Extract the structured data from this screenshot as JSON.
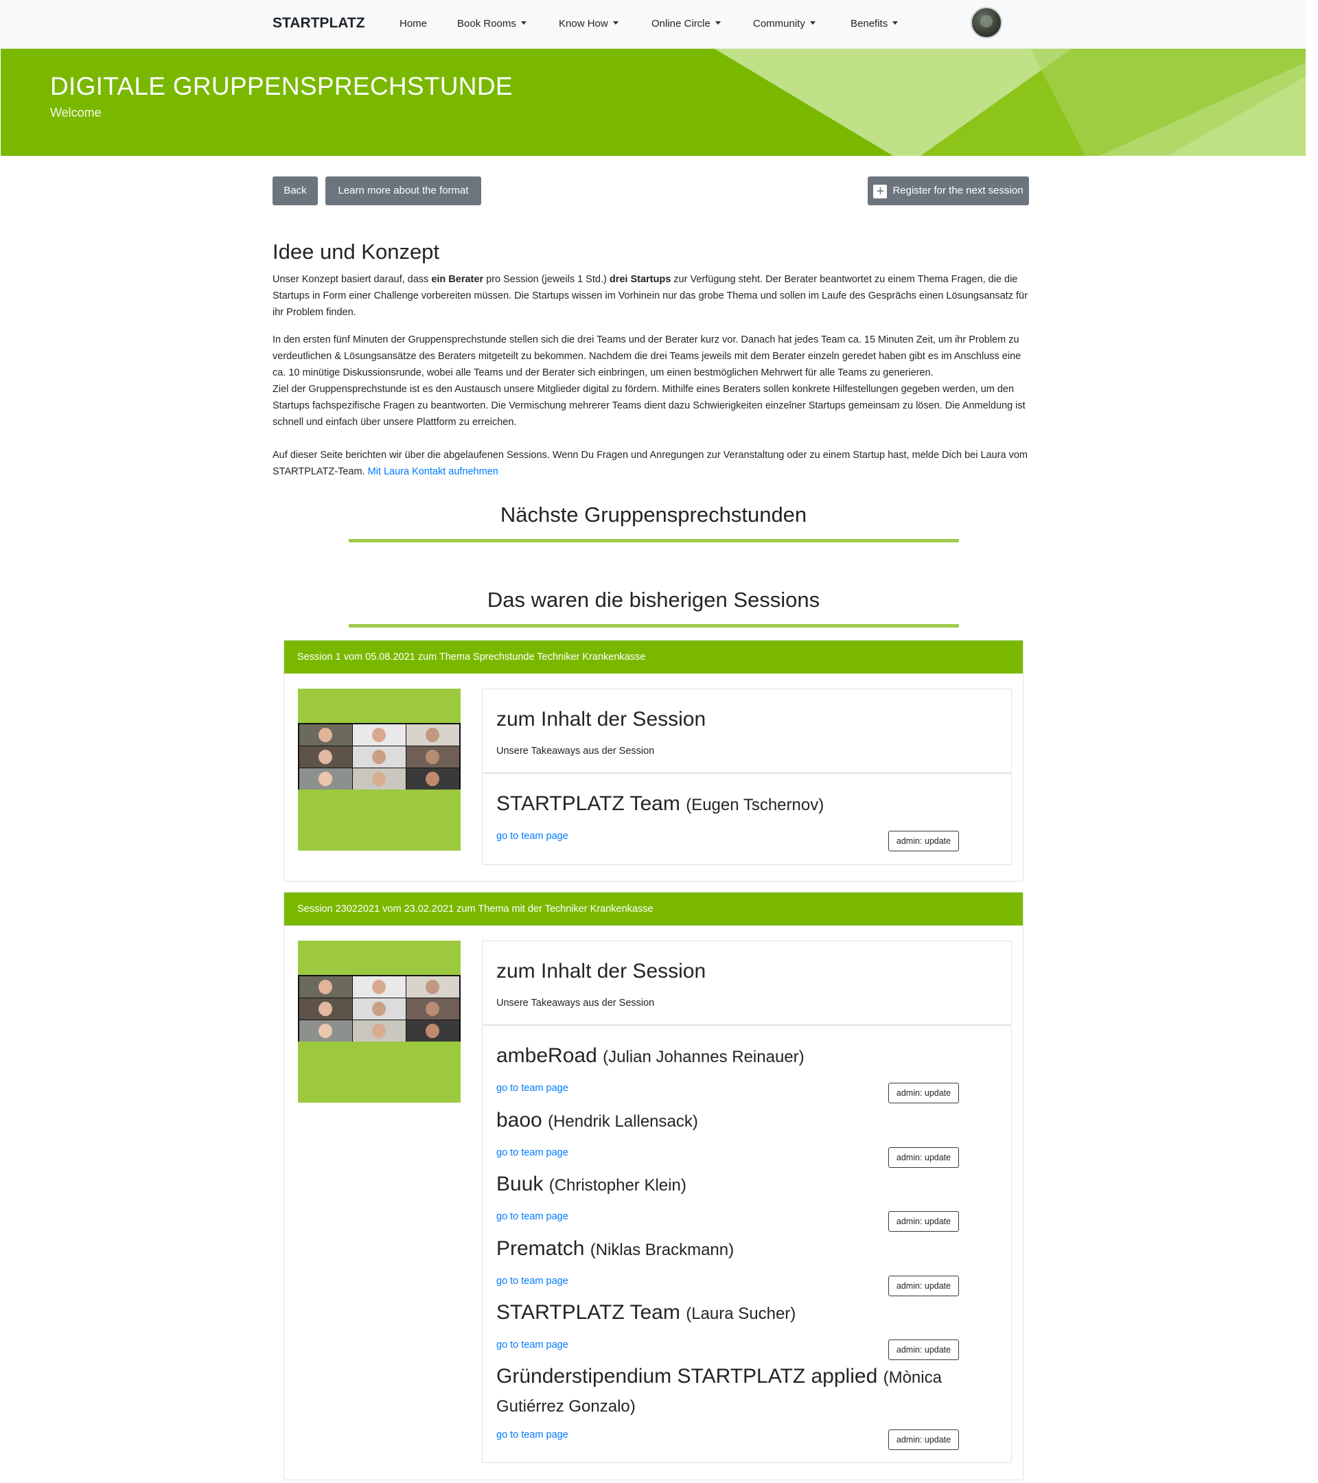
{
  "nav": {
    "brand": "STARTPLATZ",
    "items": [
      {
        "label": "Home",
        "dropdown": false
      },
      {
        "label": "Book Rooms",
        "dropdown": true
      },
      {
        "label": "Know How",
        "dropdown": true
      },
      {
        "label": "Online Circle",
        "dropdown": true
      },
      {
        "label": "Community",
        "dropdown": true
      },
      {
        "label": "Benefits",
        "dropdown": true
      }
    ]
  },
  "hero": {
    "title": "DIGITALE GRUPPENSPRECHSTUNDE",
    "subtitle": "Welcome"
  },
  "actions": {
    "back": "Back",
    "learn_more": "Learn more about the format",
    "register": "Register for the next session"
  },
  "concept": {
    "heading": "Idee und Konzept",
    "p1_a": "Unser Konzept basiert darauf, dass ",
    "p1_b": "ein Berater",
    "p1_c": " pro Session (jeweils 1 Std.) ",
    "p1_d": "drei Startups",
    "p1_e": " zur Verfügung steht. Der Berater beantwortet zu einem Thema Fragen, die die Startups in Form einer Challenge vorbereiten müssen. Die Startups wissen im Vorhinein nur das grobe Thema und sollen im Laufe des Gesprächs einen Lösungsansatz für ihr Problem finden.",
    "p2": "In den ersten fünf Minuten der Gruppensprechstunde stellen sich die drei Teams und der Berater kurz vor. Danach hat jedes Team ca. 15 Minuten Zeit, um ihr Problem zu verdeutlichen & Lösungsansätze des Beraters mitgeteilt zu bekommen. Nachdem die drei Teams jeweils mit dem Berater einzeln geredet haben gibt es im Anschluss eine ca. 10 minütige Diskussionsrunde, wobei alle Teams und der Berater sich einbringen, um einen bestmöglichen Mehrwert für alle Teams zu generieren.",
    "p3": "Ziel der Gruppensprechstunde ist es den Austausch unsere Mitglieder digital zu fördern. Mithilfe eines Beraters sollen konkrete Hilfestellungen gegeben werden, um den Startups fachspezifische Fragen zu beantworten. Die Vermischung mehrerer Teams dient dazu Schwierigkeiten einzelner Startups gemeinsam zu lösen. Die Anmeldung ist schnell und einfach über unsere Plattform zu erreichen.",
    "p4": "Auf dieser Seite berichten wir über die abgelaufenen Sessions. Wenn Du Fragen und Anregungen zur Veranstaltung oder zu einem Startup hast, melde Dich bei Laura vom STARTPLATZ-Team. ",
    "contact_link": "Mit Laura Kontakt aufnehmen"
  },
  "next_heading": "Nächste Gruppensprechstunden",
  "past_heading": "Das waren die bisherigen Sessions",
  "sessions": [
    {
      "header": "Session 1 vom 05.08.2021 zum Thema Sprechstunde Techniker Krankenkasse",
      "content_title": "zum Inhalt der Session",
      "content_sub": "Unsere Takeaways aus der Session",
      "teams": [
        {
          "name": "STARTPLATZ Team",
          "person": "(Eugen Tschernov)",
          "link": "go to team page",
          "admin": "admin: update"
        }
      ]
    },
    {
      "header": "Session 23022021 vom 23.02.2021 zum Thema mit der Techniker Krankenkasse",
      "content_title": "zum Inhalt der Session",
      "content_sub": "Unsere Takeaways aus der Session",
      "teams": [
        {
          "name": "ambeRoad",
          "person": "(Julian Johannes Reinauer)",
          "link": "go to team page",
          "admin": "admin: update"
        },
        {
          "name": "baoo",
          "person": "(Hendrik Lallensack)",
          "link": "go to team page",
          "admin": "admin: update"
        },
        {
          "name": "Buuk",
          "person": "(Christopher Klein)",
          "link": "go to team page",
          "admin": "admin: update"
        },
        {
          "name": "Prematch",
          "person": "(Niklas Brackmann)",
          "link": "go to team page",
          "admin": "admin: update"
        },
        {
          "name": "STARTPLATZ Team",
          "person": "(Laura Sucher)",
          "link": "go to team page",
          "admin": "admin: update"
        },
        {
          "name": "Gründerstipendium STARTPLATZ applied",
          "person": "(Mònica Gutiérrez Gonzalo)",
          "link": "go to team page",
          "admin": "admin: update"
        }
      ]
    }
  ],
  "colors": {
    "brand_green": "#7ab800",
    "rule_green": "#9ccb4a",
    "button_gray": "#6c757d",
    "link_blue": "#007bff"
  }
}
